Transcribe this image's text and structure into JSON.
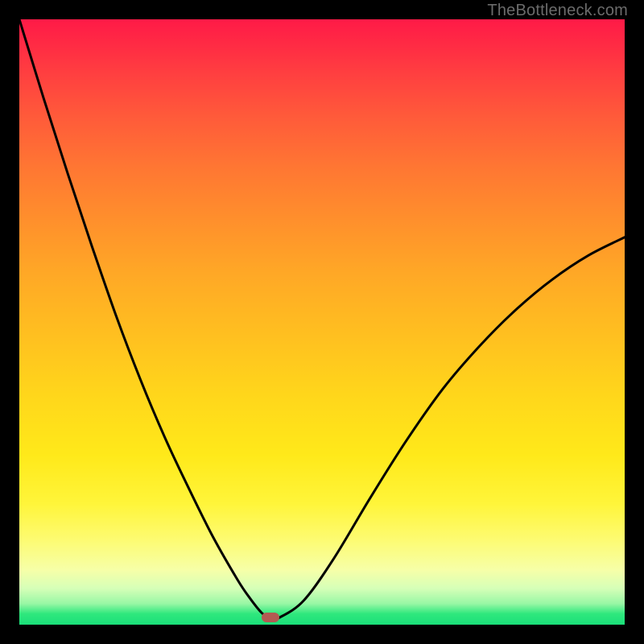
{
  "watermark": "TheBottleneck.com",
  "chart_data": {
    "type": "line",
    "title": "",
    "xlabel": "",
    "ylabel": "",
    "xlim": [
      0,
      1
    ],
    "ylim": [
      0,
      1
    ],
    "series": [
      {
        "name": "curve",
        "x": [
          0.0,
          0.04,
          0.08,
          0.12,
          0.16,
          0.2,
          0.24,
          0.28,
          0.32,
          0.36,
          0.38,
          0.4,
          0.415,
          0.43,
          0.47,
          0.52,
          0.58,
          0.64,
          0.7,
          0.76,
          0.82,
          0.88,
          0.94,
          1.0
        ],
        "y": [
          1.0,
          0.87,
          0.745,
          0.625,
          0.51,
          0.405,
          0.31,
          0.225,
          0.145,
          0.075,
          0.045,
          0.02,
          0.01,
          0.012,
          0.04,
          0.11,
          0.21,
          0.305,
          0.39,
          0.46,
          0.52,
          0.57,
          0.61,
          0.64
        ]
      }
    ],
    "marker": {
      "x": 0.415,
      "y": 0.012
    },
    "colors": {
      "curve": "#000000",
      "marker": "#b35a52",
      "frame": "#000000"
    }
  }
}
